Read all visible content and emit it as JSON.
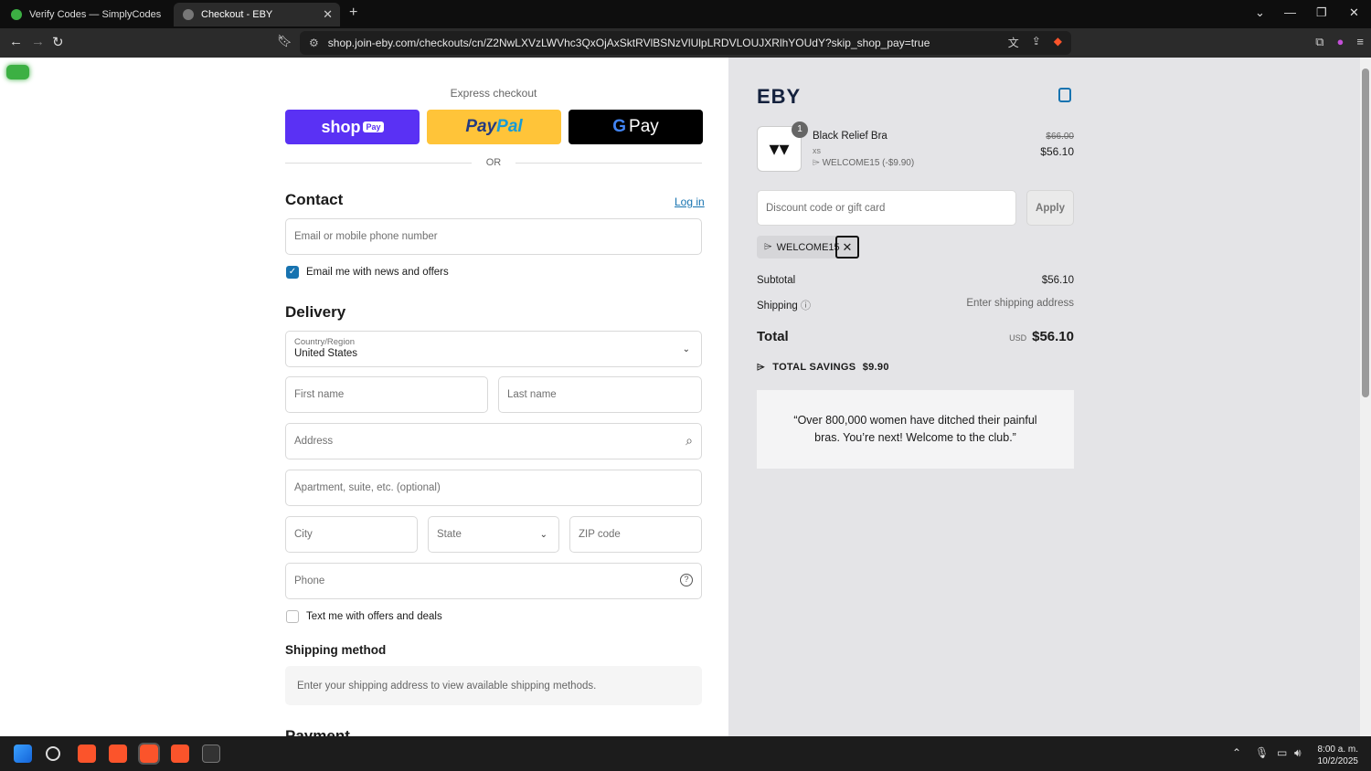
{
  "browser": {
    "tabs": [
      {
        "title": "Verify Codes — SimplyCodes",
        "active": false
      },
      {
        "title": "Checkout - EBY",
        "active": true
      }
    ],
    "url": "shop.join-eby.com/checkouts/cn/Z2NwLXVzLWVhc3QxOjAxSktRVlBSNzVlUlpLRDVLOUJXRlhYOUdY?skip_shop_pay=true"
  },
  "checkout": {
    "express_title": "Express checkout",
    "shop_label": "shop",
    "shop_pay_label": "Pay",
    "paypal_label_1": "Pay",
    "paypal_label_2": "Pal",
    "gpay_g": "G",
    "gpay_label": "Pay",
    "or_label": "OR",
    "contact_heading": "Contact",
    "login_link": "Log in",
    "email_placeholder": "Email or mobile phone number",
    "email_news_label": "Email me with news and offers",
    "email_news_checked": true,
    "delivery_heading": "Delivery",
    "country_label": "Country/Region",
    "country_value": "United States",
    "first_name_placeholder": "First name",
    "last_name_placeholder": "Last name",
    "address_placeholder": "Address",
    "apartment_placeholder": "Apartment, suite, etc. (optional)",
    "city_placeholder": "City",
    "state_placeholder": "State",
    "zip_placeholder": "ZIP code",
    "phone_placeholder": "Phone",
    "text_offers_label": "Text me with offers and deals",
    "text_offers_checked": false,
    "shipping_method_heading": "Shipping method",
    "shipping_method_message": "Enter your shipping address to view available shipping methods.",
    "payment_heading": "Payment"
  },
  "summary": {
    "logo": "EBY",
    "item": {
      "quantity": "1",
      "name": "Black Relief Bra",
      "variant": "xs",
      "discount": "WELCOME15 (-$9.90)",
      "old_price": "$66.00",
      "price": "$56.10"
    },
    "discount_placeholder": "Discount code or gift card",
    "apply_label": "Apply",
    "applied_code": "WELCOME15",
    "subtotal_label": "Subtotal",
    "subtotal_value": "$56.10",
    "shipping_label": "Shipping",
    "shipping_value": "Enter shipping address",
    "total_label": "Total",
    "currency": "USD",
    "total_value": "$56.10",
    "savings_label": "TOTAL SAVINGS",
    "savings_value": "$9.90",
    "quote": "“Over 800,000 women have ditched their painful bras. You’re next! Welcome to the club.”"
  },
  "taskbar": {
    "time": "8:00 a. m.",
    "date": "10/2/2025"
  },
  "colors": {
    "shop_pay": "#5a31f4",
    "paypal": "#ffc439",
    "link": "#1773b0"
  }
}
